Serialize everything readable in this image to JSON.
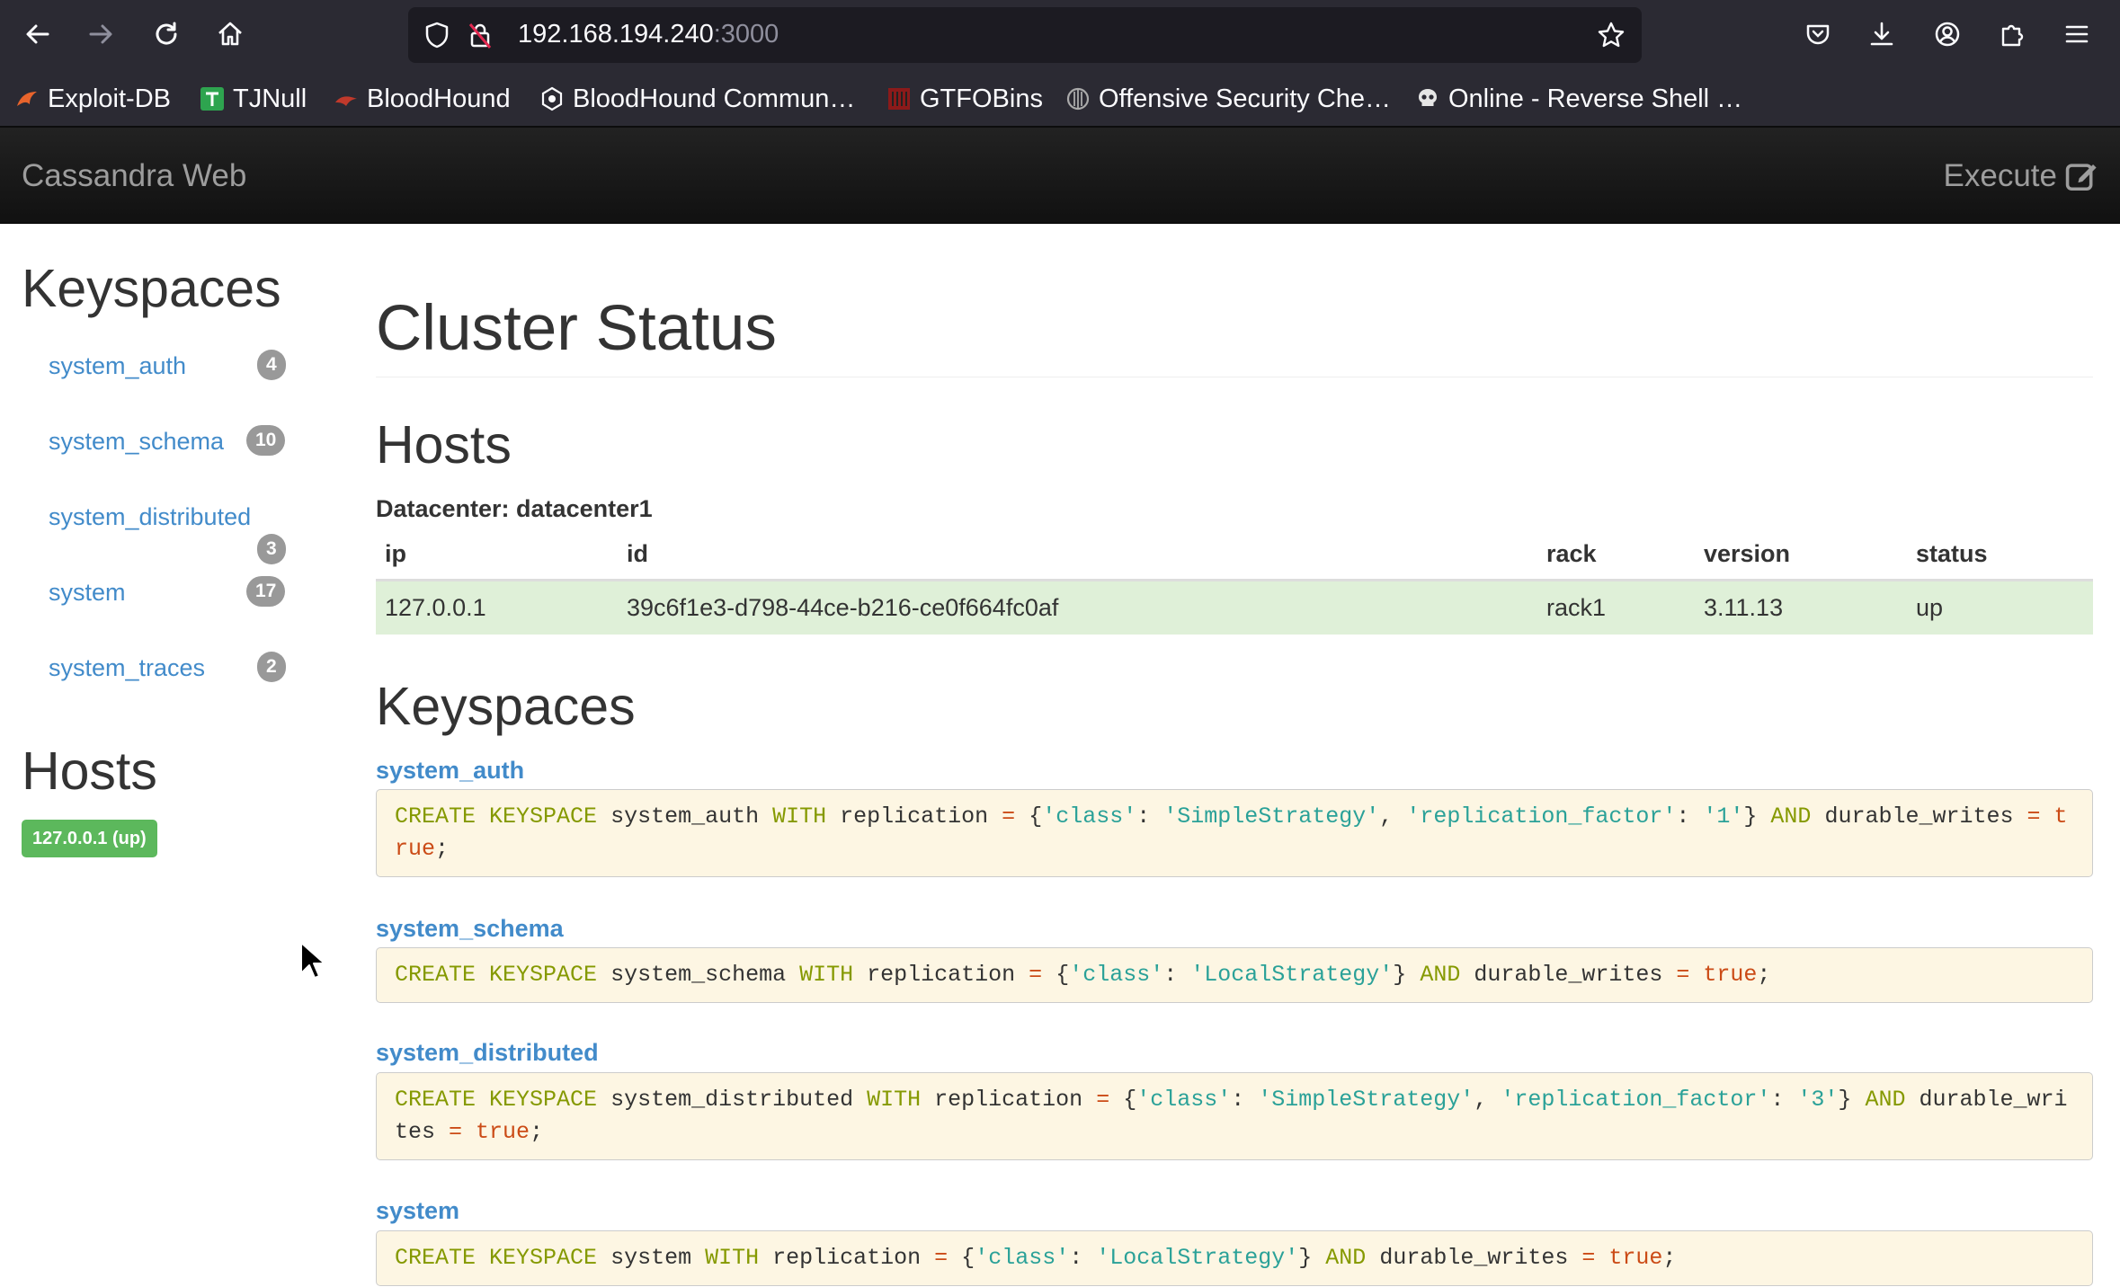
{
  "browser": {
    "url_host": "192.168.194.240",
    "url_port": ":3000",
    "bookmarks": [
      {
        "label": "Exploit-DB",
        "icon": "exploit-db-icon"
      },
      {
        "label": "TJNull",
        "icon": "tjnull-icon"
      },
      {
        "label": "BloodHound",
        "icon": "bloodhound-icon"
      },
      {
        "label": "BloodHound Commun…",
        "icon": "bloodhound-community-icon"
      },
      {
        "label": "GTFOBins",
        "icon": "gtfobins-icon"
      },
      {
        "label": "Offensive Security Che…",
        "icon": "offsec-icon"
      },
      {
        "label": "Online - Reverse Shell …",
        "icon": "skull-icon"
      }
    ]
  },
  "navbar": {
    "brand": "Cassandra Web",
    "execute_label": "Execute"
  },
  "sidebar": {
    "keyspaces_heading": "Keyspaces",
    "keyspaces": [
      {
        "name": "system_auth",
        "count": "4"
      },
      {
        "name": "system_schema",
        "count": "10"
      },
      {
        "name": "system_distributed",
        "count": "3"
      },
      {
        "name": "system",
        "count": "17"
      },
      {
        "name": "system_traces",
        "count": "2"
      }
    ],
    "hosts_heading": "Hosts",
    "host_label": "127.0.0.1 (up)"
  },
  "main": {
    "title": "Cluster Status",
    "hosts_heading": "Hosts",
    "datacenter": "Datacenter: datacenter1",
    "table": {
      "columns": [
        "ip",
        "id",
        "rack",
        "version",
        "status"
      ],
      "rows": [
        [
          "127.0.0.1",
          "39c6f1e3-d798-44ce-b216-ce0f664fc0af",
          "rack1",
          "3.11.13",
          "up"
        ]
      ]
    },
    "keyspaces_heading": "Keyspaces",
    "keyspaces": [
      {
        "name": "system_auth",
        "cql": "CREATE KEYSPACE system_auth WITH replication = {'class': 'SimpleStrategy', 'replication_factor': '1'} AND durable_writes = true;"
      },
      {
        "name": "system_schema",
        "cql": "CREATE KEYSPACE system_schema WITH replication = {'class': 'LocalStrategy'} AND durable_writes = true;"
      },
      {
        "name": "system_distributed",
        "cql": "CREATE KEYSPACE system_distributed WITH replication = {'class': 'SimpleStrategy', 'replication_factor': '3'} AND durable_writes = true;"
      },
      {
        "name": "system",
        "cql": "CREATE KEYSPACE system WITH replication = {'class': 'LocalStrategy'} AND durable_writes = true;"
      }
    ]
  },
  "colors": {
    "link": "#428bca",
    "up_row": "#dff0d8",
    "host_label": "#5cb85c",
    "code_bg": "#fdf6e3"
  }
}
